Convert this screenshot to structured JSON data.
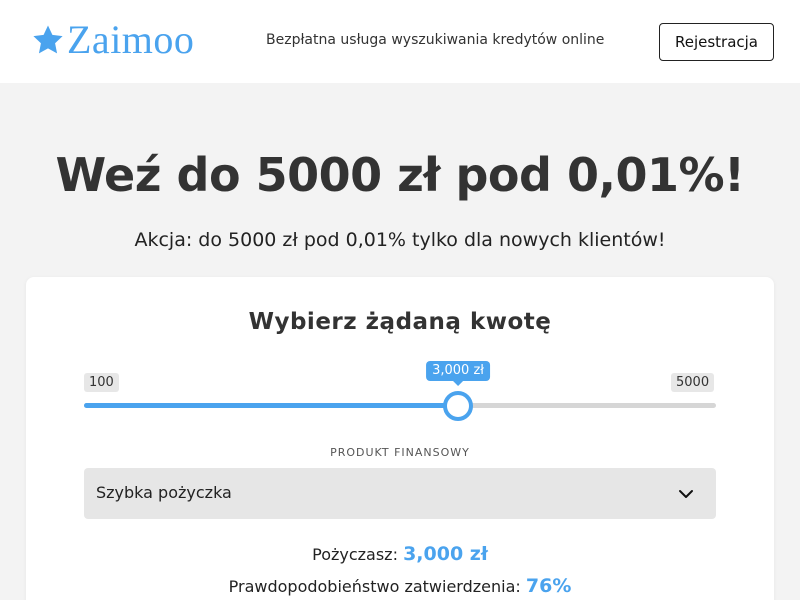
{
  "header": {
    "logo_text": "Zaimoo",
    "tagline": "Bezpłatna usługa wyszukiwania kredytów online",
    "register_label": "Rejestracja"
  },
  "hero": {
    "title": "Weź do 5000 zł pod 0,01%!",
    "subtitle": "Akcja: do 5000 zł pod 0,01% tylko dla nowych klientów!"
  },
  "calculator": {
    "title": "Wybierz żądaną kwotę",
    "slider": {
      "min_label": "100",
      "max_label": "5000",
      "min": 100,
      "max": 5000,
      "value": 3000,
      "value_label": "3,000 zł"
    },
    "product_label": "PRODUKT FINANSOWY",
    "product_value": "Szybka pożyczka",
    "borrow_label": "Pożyczasz:",
    "borrow_value": "3,000 zł",
    "approval_label": "Prawdopodobieństwo zatwierdzenia:",
    "approval_value": "76%"
  },
  "colors": {
    "accent": "#4aa3ee",
    "background": "#f3f3f3"
  }
}
